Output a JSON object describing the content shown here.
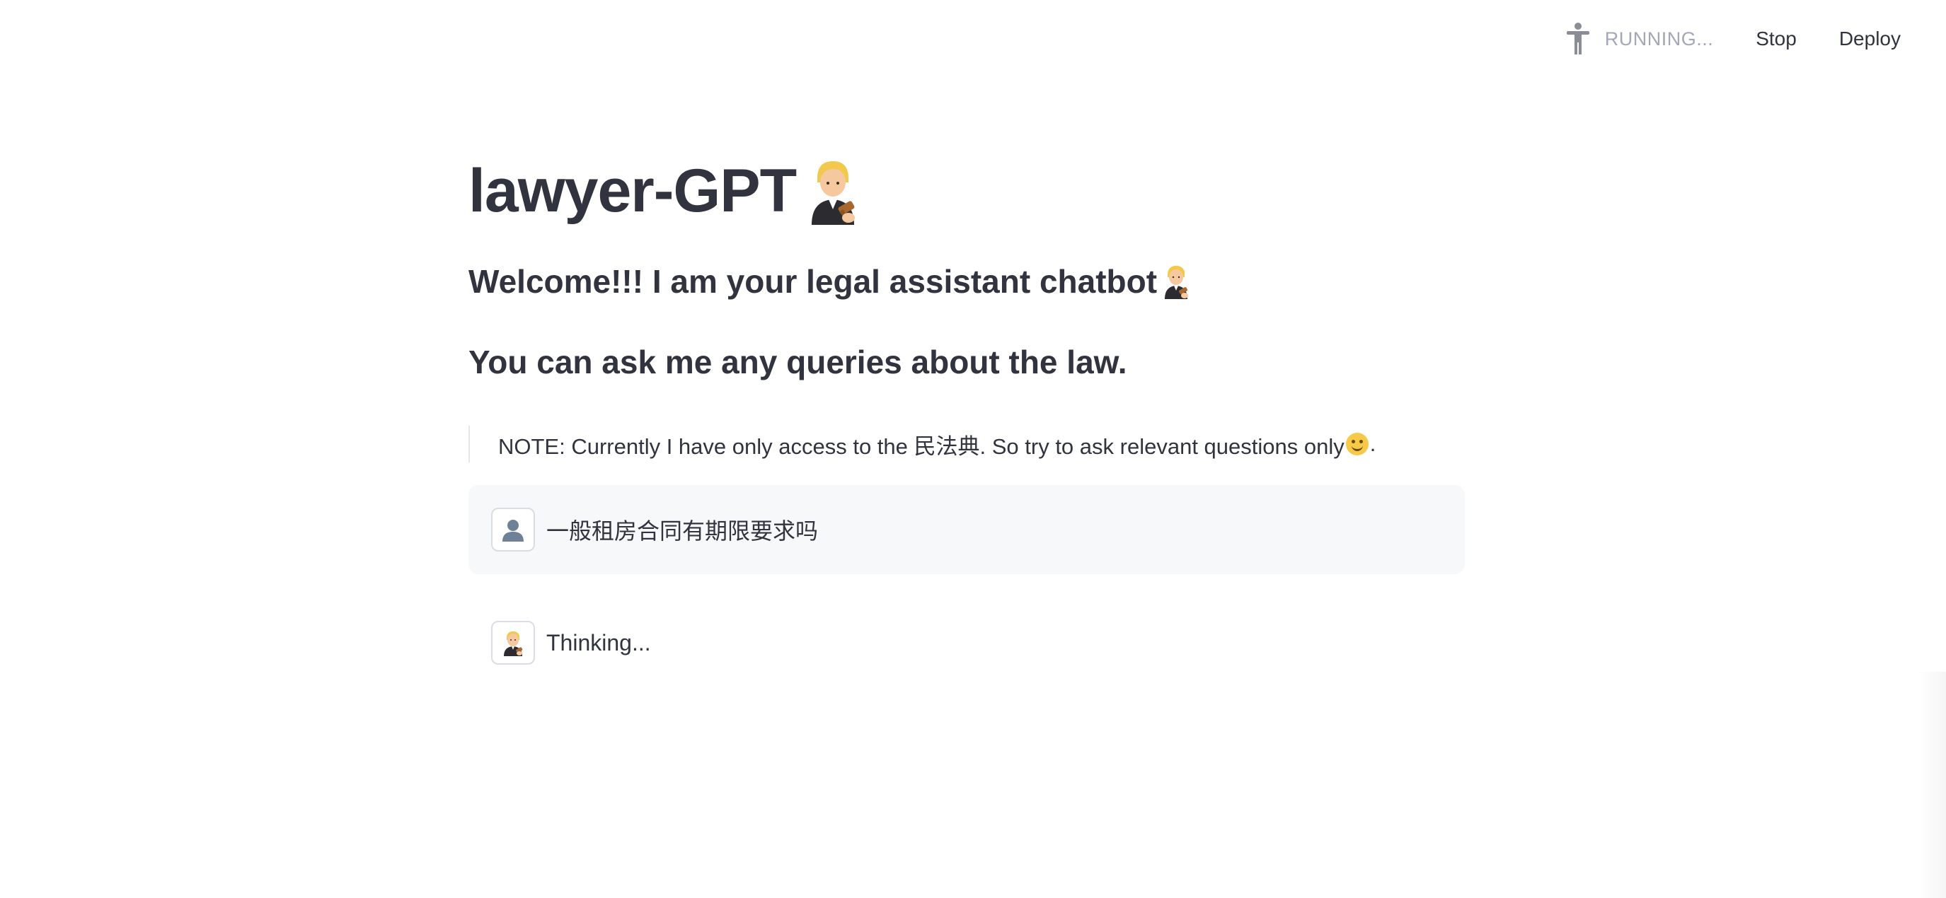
{
  "header": {
    "status_icon": "running-person-icon",
    "status_text": "RUNNING...",
    "stop_label": "Stop",
    "deploy_label": "Deploy"
  },
  "main": {
    "title": "lawyer-GPT",
    "title_icon": "lawyer-emoji-icon",
    "welcome": "Welcome!!! I am your legal assistant chatbot",
    "welcome_icon": "lawyer-emoji-icon",
    "subhead": "You can ask me any queries about the law.",
    "note_text": "NOTE: Currently I have only access to the 民法典. So try to ask relevant questions only",
    "note_icon": "smile-emoji-icon",
    "note_end": "."
  },
  "chat": {
    "messages": [
      {
        "role": "user",
        "avatar_icon": "user-silhouette-icon",
        "text": "一般租房合同有期限要求吗"
      },
      {
        "role": "assistant",
        "avatar_icon": "lawyer-emoji-icon",
        "text": "Thinking..."
      }
    ]
  },
  "colors": {
    "text": "#31333f",
    "muted": "#a3a8b8",
    "user_bubble_bg": "#f7f8fa",
    "border": "#dcdde2"
  }
}
